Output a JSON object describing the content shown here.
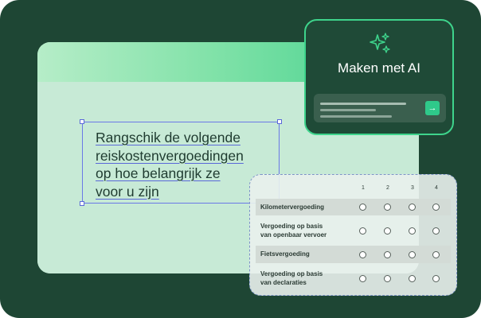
{
  "question": {
    "lines": [
      "Rangschik de volgende",
      "reiskostenvergoedingen",
      "op hoe belangrijk ze",
      "voor u zijn"
    ]
  },
  "ai_card": {
    "icon": "sparkle-icon",
    "title": "Maken met AI",
    "send_icon": "arrow-right-icon",
    "send_glyph": "→"
  },
  "matrix": {
    "columns": [
      "1",
      "2",
      "3",
      "4"
    ],
    "rows": [
      {
        "label_lines": [
          "Kilometervergoeding"
        ]
      },
      {
        "label_lines": [
          "Vergoeding op basis",
          "van openbaar vervoer"
        ]
      },
      {
        "label_lines": [
          "Fietsvergoeding"
        ]
      },
      {
        "label_lines": [
          "Vergoeding op basis",
          "van declaraties"
        ]
      }
    ]
  },
  "colors": {
    "background": "#1e4634",
    "accent": "#3ed48c",
    "selection": "#6a78e6"
  }
}
